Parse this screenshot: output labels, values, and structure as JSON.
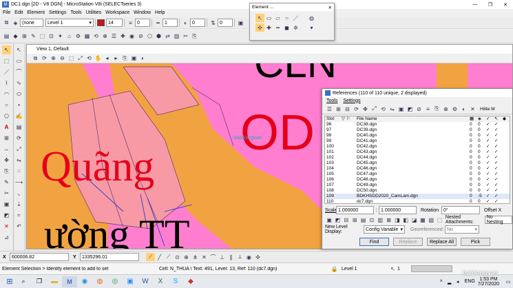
{
  "titlebar": {
    "title": "DC1.dgn [2D - V8 DGN] - MicroStation V8i (SELECTseries 3)"
  },
  "menu": [
    "File",
    "Edit",
    "Element",
    "Settings",
    "Tools",
    "Utilities",
    "Workspace",
    "Window",
    "Help"
  ],
  "attributes": {
    "active_level_prefix": "(none",
    "level": "Level 1",
    "color_index": "14",
    "style_index": "0",
    "weight_index": "1",
    "transparency": "0",
    "priority": "0"
  },
  "element_dialog": {
    "title": "Element ..."
  },
  "view": {
    "title": "View 1, Default"
  },
  "canvas_text": {
    "quang": "Quãng",
    "thuong": "ường  TT",
    "odn": "OD",
    "cln": "CLN",
    "watermark_small": "batdongsan"
  },
  "references": {
    "title": "References (110 of 110 unique, 2 displayed)",
    "menu": [
      "Tools",
      "Settings"
    ],
    "columns": {
      "slot": "Slot",
      "file_name": "File Name"
    },
    "hilite_label": "Hilite M",
    "rows": [
      {
        "slot": "96",
        "file": "DC38.dgn",
        "a": "0",
        "b": "0",
        "c": "✓",
        "d": "✓"
      },
      {
        "slot": "97",
        "file": "DC39.dgn",
        "a": "0",
        "b": "0",
        "c": "✓",
        "d": "✓"
      },
      {
        "slot": "98",
        "file": "DC40.dgn",
        "a": "0",
        "b": "0",
        "c": "✓",
        "d": "✓"
      },
      {
        "slot": "99",
        "file": "DC41.dgn",
        "a": "0",
        "b": "0",
        "c": "✓",
        "d": "✓"
      },
      {
        "slot": "100",
        "file": "DC42.dgn",
        "a": "0",
        "b": "0",
        "c": "✓",
        "d": "✓"
      },
      {
        "slot": "101",
        "file": "DC43.dgn",
        "a": "0",
        "b": "0",
        "c": "✓",
        "d": "✓"
      },
      {
        "slot": "102",
        "file": "DC44.dgn",
        "a": "0",
        "b": "0",
        "c": "✓",
        "d": "✓"
      },
      {
        "slot": "103",
        "file": "DC45.dgn",
        "a": "0",
        "b": "0",
        "c": "✓",
        "d": "✓"
      },
      {
        "slot": "104",
        "file": "DC46.dgn",
        "a": "0",
        "b": "0",
        "c": "✓",
        "d": "✓"
      },
      {
        "slot": "105",
        "file": "DC47.dgn",
        "a": "0",
        "b": "0",
        "c": "✓",
        "d": "✓"
      },
      {
        "slot": "106",
        "file": "DC48.dgn",
        "a": "0",
        "b": "0",
        "c": "✓",
        "d": "✓"
      },
      {
        "slot": "107",
        "file": "DC49.dgn",
        "a": "0",
        "b": "0",
        "c": "✓",
        "d": "✓"
      },
      {
        "slot": "108",
        "file": "DC50.dgn",
        "a": "0",
        "b": "0",
        "c": "✓",
        "d": "✓"
      },
      {
        "slot": "109",
        "file": "BDKHSDD2020_CamLam.dgn",
        "a": "0",
        "b": "-5",
        "c": "✓",
        "d": "✓"
      },
      {
        "slot": "110",
        "file": "dc7.dgn",
        "a": "0",
        "b": "0",
        "c": "✓",
        "d": "✓"
      }
    ],
    "scale_label": "Scale",
    "scale_a": "1.000000",
    "scale_b": "1.000000",
    "rotation_label": "Rotation",
    "rotation_value": "0°",
    "offset_label": "Offset X",
    "nested_label": "Nested Attachments:",
    "nested_value": "No Nesting",
    "new_level_label": "New Level Display:",
    "new_level_value": "Config Variable",
    "georef_label": "Georeferenced:",
    "georef_value": "No",
    "buttons": {
      "find": "Find",
      "replace": "Replace",
      "replace_all": "Replace All",
      "pick": "Pick"
    }
  },
  "coords": {
    "x_label": "X",
    "x_value": "600006.82",
    "y_label": "Y",
    "y_value": "1335296.01"
  },
  "status": {
    "prompt": "Element Selection > Identify element to add to set",
    "cell_info": "Cell: N_THUA \\ Text: 491, Level: 13, Ref: 110 (dc7.dgn)",
    "level": "Level 1",
    "count": "1"
  },
  "taskbar": {
    "lang": "ENG",
    "time": "1:53 PM",
    "date": "7/27/2020",
    "watermark": "batdongsan"
  },
  "colors": {
    "canvas_pink": "#ff7ecf",
    "canvas_orange": "#f2a341",
    "canvas_red_text": "#e5001a",
    "canvas_black_text": "#000000"
  }
}
